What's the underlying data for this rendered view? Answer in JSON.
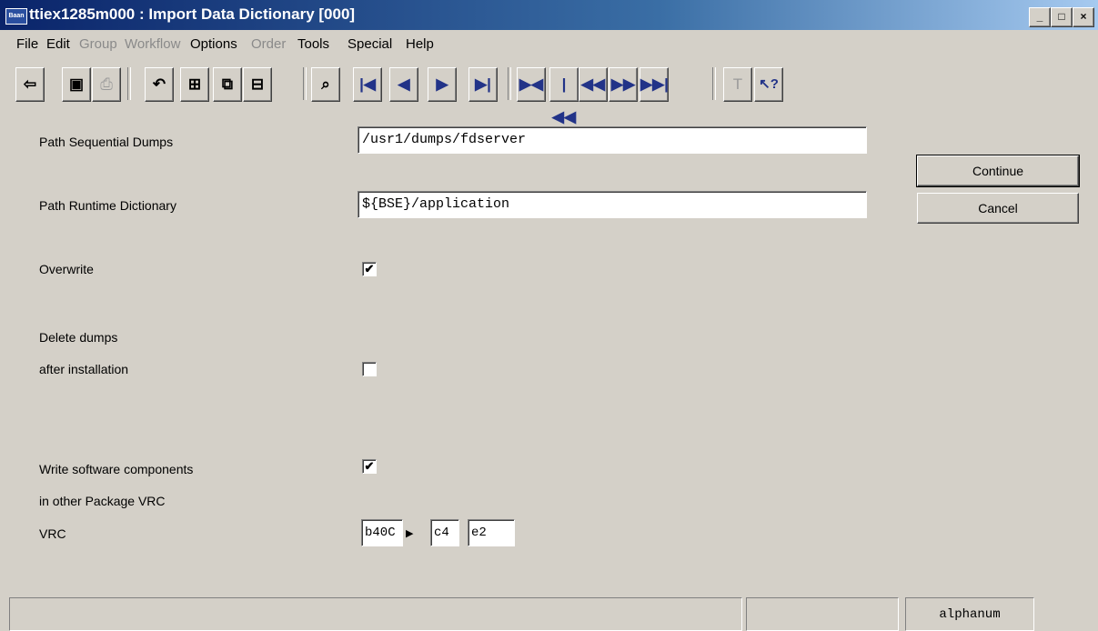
{
  "window": {
    "title": "ttiex1285m000 : Import Data Dictionary [000]",
    "icon_text": "Baan",
    "controls": [
      "_",
      "□",
      "×"
    ]
  },
  "menu": [
    {
      "label": "File",
      "enabled": true
    },
    {
      "label": "Edit",
      "enabled": true
    },
    {
      "label": "Group",
      "enabled": false
    },
    {
      "label": "Workflow",
      "enabled": false
    },
    {
      "label": "Options",
      "enabled": true
    },
    {
      "label": "Order",
      "enabled": false
    },
    {
      "label": "Tools",
      "enabled": true
    },
    {
      "label": "Special",
      "enabled": true
    },
    {
      "label": "Help",
      "enabled": true
    }
  ],
  "toolbar": {
    "icons": [
      "exit-icon",
      "save-icon",
      "print-icon",
      "undo-icon",
      "insert-icon",
      "copy-icon",
      "delete-icon",
      "find-icon",
      "first-icon",
      "previous-icon",
      "next-icon",
      "last-icon",
      "first-set-icon",
      "previous-set-icon",
      "previous-group-icon",
      "next-group-icon",
      "last-set-icon",
      "text-icon",
      "help-icon"
    ],
    "glyphs": [
      "⇦",
      "▣",
      "⎙",
      "↶",
      "⊞",
      "⧉",
      "⊟",
      "⌕",
      "|◀",
      "◀",
      "▶",
      "▶|",
      "▶◀",
      "|◀◀",
      "◀◀",
      "▶▶",
      "▶▶|",
      "T",
      "↖?"
    ]
  },
  "form": {
    "path_sequential_dumps": {
      "label": "Path Sequential Dumps",
      "value": "/usr1/dumps/fdserver"
    },
    "path_runtime_dictionary": {
      "label": "Path Runtime Dictionary",
      "value": "${BSE}/application"
    },
    "overwrite": {
      "label": "Overwrite",
      "checked": true,
      "mark": "✔"
    },
    "delete_dumps": {
      "label_line1": "Delete dumps",
      "label_line2": "after installation",
      "checked": false,
      "mark": ""
    },
    "write_software": {
      "label_line1": "Write software components",
      "label_line2": "in other Package VRC",
      "checked": true,
      "mark": "✔"
    },
    "vrc": {
      "label": "VRC",
      "version": "b40C",
      "release": "c4",
      "customer": "e2"
    }
  },
  "buttons": {
    "continue": "Continue",
    "cancel": "Cancel"
  },
  "status": {
    "field_type": "alphanum"
  }
}
